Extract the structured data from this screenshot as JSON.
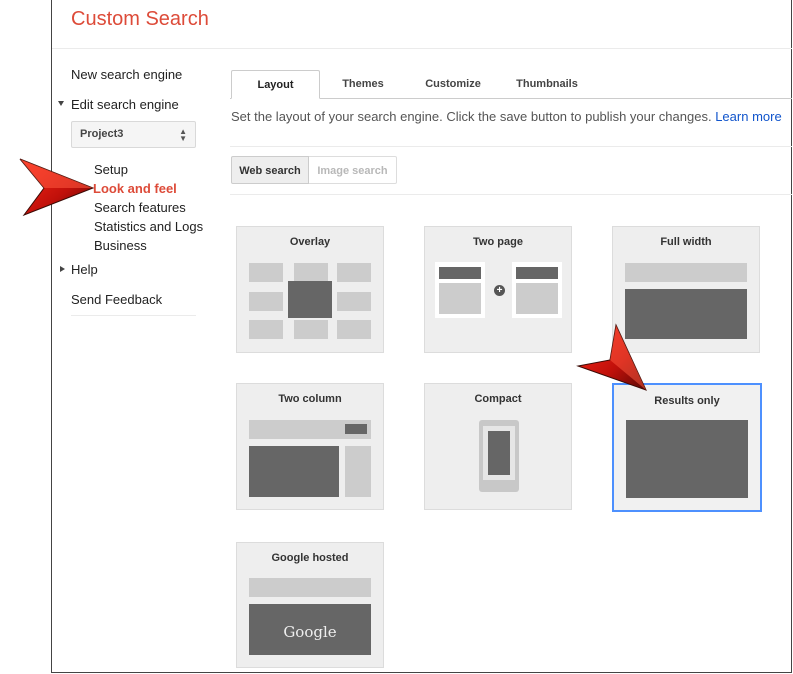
{
  "app": {
    "title": "Custom Search"
  },
  "sidebar": {
    "new_engine": "New search engine",
    "edit_engine": "Edit search engine",
    "project": "Project3",
    "items": [
      "Setup",
      "Look and feel",
      "Search features",
      "Statistics and Logs",
      "Business"
    ],
    "active_item": "Look and feel",
    "help": "Help",
    "feedback": "Send Feedback"
  },
  "tabs": [
    "Layout",
    "Themes",
    "Customize",
    "Thumbnails"
  ],
  "active_tab": "Layout",
  "description": "Set the layout of your search engine. Click the save button to publish your changes.",
  "learn_more": "Learn more",
  "search_type": {
    "web": "Web search",
    "image": "Image search",
    "selected": "Web search"
  },
  "layouts": [
    "Overlay",
    "Two page",
    "Full width",
    "Two column",
    "Compact",
    "Results only",
    "Google hosted"
  ],
  "selected_layout": "Results only",
  "google_logo_text": "Google",
  "colors": {
    "brand": "#dd4b39",
    "link": "#1155cc",
    "selection": "#4d90fe",
    "dark_block": "#666666",
    "light_block": "#cccccc"
  }
}
